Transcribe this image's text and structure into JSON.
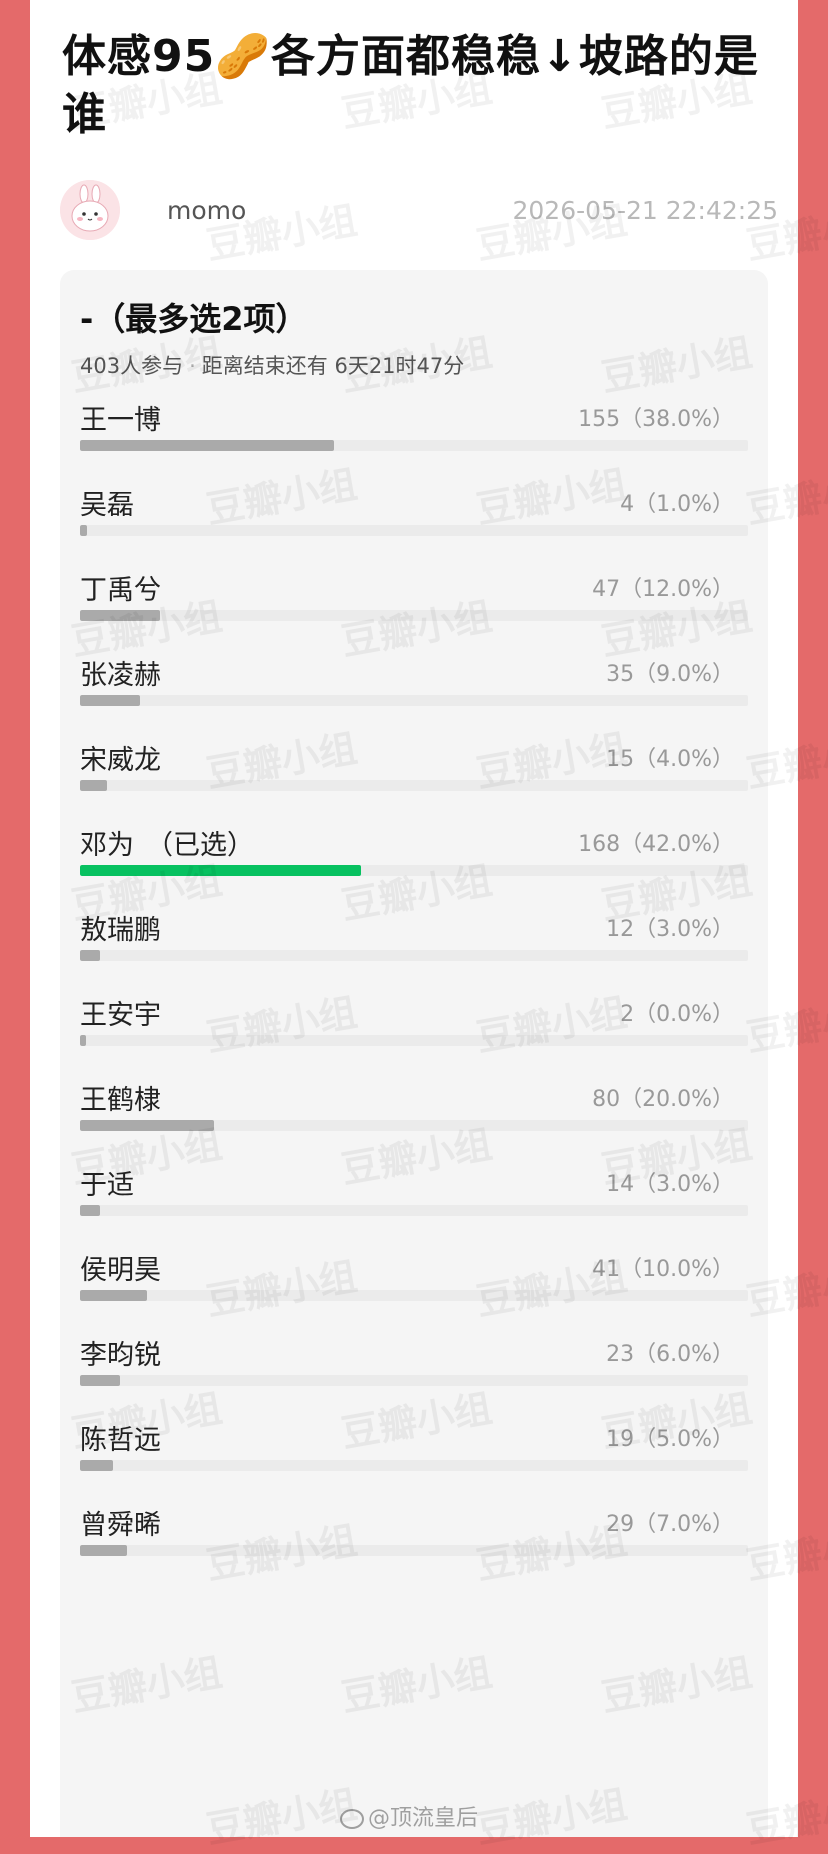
{
  "post": {
    "title": "体感95🥜各方面都稳稳↓坡路的是谁",
    "author": "momo",
    "time": "2026-05-21 22:42:25"
  },
  "poll": {
    "title": "-（最多选2项）",
    "participants": "403人参与",
    "remaining": "距离结束还有 6天21时47分",
    "selected_tag": "（已选）",
    "options": [
      {
        "name": "王一博",
        "votes": "155（38.0%）",
        "percent": 38.0,
        "selected": false
      },
      {
        "name": "吴磊",
        "votes": "4（1.0%）",
        "percent": 1.0,
        "selected": false
      },
      {
        "name": "丁禹兮",
        "votes": "47（12.0%）",
        "percent": 12.0,
        "selected": false
      },
      {
        "name": "张凌赫",
        "votes": "35（9.0%）",
        "percent": 9.0,
        "selected": false
      },
      {
        "name": "宋威龙",
        "votes": "15（4.0%）",
        "percent": 4.0,
        "selected": false
      },
      {
        "name": "邓为",
        "votes": "168（42.0%）",
        "percent": 42.0,
        "selected": true
      },
      {
        "name": "敖瑞鹏",
        "votes": "12（3.0%）",
        "percent": 3.0,
        "selected": false
      },
      {
        "name": "王安宇",
        "votes": "2（0.0%）",
        "percent": 0.0,
        "selected": false
      },
      {
        "name": "王鹤棣",
        "votes": "80（20.0%）",
        "percent": 20.0,
        "selected": false
      },
      {
        "name": "于适",
        "votes": "14（3.0%）",
        "percent": 3.0,
        "selected": false
      },
      {
        "name": "侯明昊",
        "votes": "41（10.0%）",
        "percent": 10.0,
        "selected": false
      },
      {
        "name": "李昀锐",
        "votes": "23（6.0%）",
        "percent": 6.0,
        "selected": false
      },
      {
        "name": "陈哲远",
        "votes": "19（5.0%）",
        "percent": 5.0,
        "selected": false
      },
      {
        "name": "曾舜晞",
        "votes": "29（7.0%）",
        "percent": 7.0,
        "selected": false
      }
    ]
  },
  "watermark": {
    "text": "豆瓣小组",
    "credit": "@顶流皇后"
  },
  "colors": {
    "background": "#e46a6a",
    "bar_default": "#aaaaaa",
    "bar_selected": "#07c160",
    "track": "#ebebeb"
  }
}
